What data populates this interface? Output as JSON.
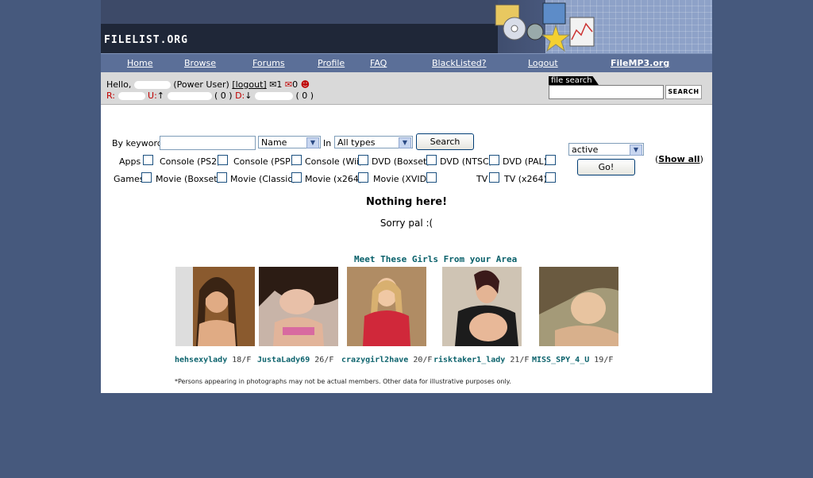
{
  "site": {
    "logo": "FILELIST.ORG"
  },
  "nav": {
    "items": [
      "Home",
      "Browse",
      "Forums",
      "Profile",
      "FAQ",
      "BlackListed?",
      "Logout"
    ],
    "external": "FileMP3.org"
  },
  "user": {
    "hello": "Hello,",
    "role": "(Power User)",
    "logout": "[logout]",
    "inbox_count": "1",
    "outbox_count": "0",
    "r_label": "R:",
    "u_label": "U:",
    "u_arrow": "↑",
    "u_count": "( 0 )",
    "d_label": "D:",
    "d_arrow": "↓",
    "d_count": "( 0 )"
  },
  "file_search": {
    "label": "file search",
    "button": "SEARCH"
  },
  "search": {
    "keyword_label": "By keyword",
    "field_select": "Name",
    "in_label": "In",
    "type_select": "All types",
    "button": "Search",
    "status_select": "active",
    "go_button": "Go!",
    "show_all": "Show all"
  },
  "categories": {
    "row1": [
      "Apps",
      "Console (PS2)",
      "Console (PSP)",
      "Console (Wii)",
      "DVD (Boxset)",
      "DVD (NTSC)",
      "DVD (PAL)"
    ],
    "row2": [
      "Games",
      "Movie (Boxset)",
      "Movie (Classic)",
      "Movie (x264)",
      "Movie (XVID)",
      "TV",
      "TV (x264)"
    ]
  },
  "results": {
    "heading": "Nothing here!",
    "message": "Sorry pal :("
  },
  "ad": {
    "title": "Meet These Girls From your Area",
    "profiles": [
      {
        "name": "hehsexylady",
        "info": "18/F"
      },
      {
        "name": "JustaLady69",
        "info": "26/F"
      },
      {
        "name": "crazygirl2have",
        "info": "20/F"
      },
      {
        "name": "risktaker1_lady",
        "info": "21/F"
      },
      {
        "name": "MISS_SPY_4_U",
        "info": "19/F"
      }
    ],
    "disclaimer": "*Persons appearing in photographs may not be actual members. Other data for illustrative purposes only."
  },
  "colors": {
    "page_bg": "#46597d",
    "nav_bg": "#5b6f98",
    "userbar_bg": "#d9d9d9",
    "ad_text": "#08606a",
    "alert_red": "#c00000"
  }
}
